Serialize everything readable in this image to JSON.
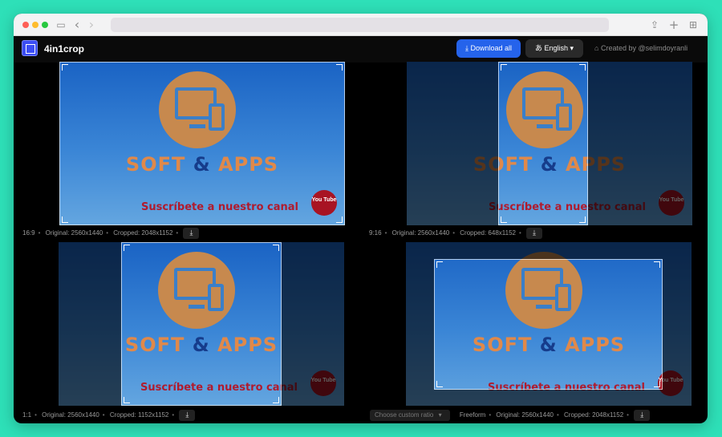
{
  "browser": {
    "back_icon": "‹",
    "forward_icon": "›",
    "sidebar_icon": "▭",
    "share_icon": "⇪",
    "newtab_icon": "+",
    "tabs_icon": "⊞"
  },
  "header": {
    "app_name": "4in1crop",
    "download_all": "Download all",
    "language": "English",
    "credit": "Created by @selimdoyranli"
  },
  "image": {
    "brand_left": "SOFT",
    "brand_amp": "&",
    "brand_right": "APPS",
    "subscribe": "Suscríbete a nuestro canal",
    "yt_label": "You Tube"
  },
  "panels": [
    {
      "ratio": "16:9",
      "original": "Original: 2560x1440",
      "cropped": "Cropped: 2048x1152"
    },
    {
      "ratio": "9:16",
      "original": "Original: 2560x1440",
      "cropped": "Cropped: 648x1152"
    },
    {
      "ratio": "1:1",
      "original": "Original: 2560x1440",
      "cropped": "Cropped: 1152x1152"
    },
    {
      "ratio": "Freeform",
      "original": "Original: 2560x1440",
      "cropped": "Cropped: 2048x1152",
      "custom": "Choose custom ratio"
    }
  ],
  "separator": "•",
  "download_icon": "⤓",
  "colors": {
    "accent": "#2563eb",
    "background": "#2ee0b8",
    "brand_orange": "#e0894a",
    "subscribe_red": "#b01b2e"
  }
}
